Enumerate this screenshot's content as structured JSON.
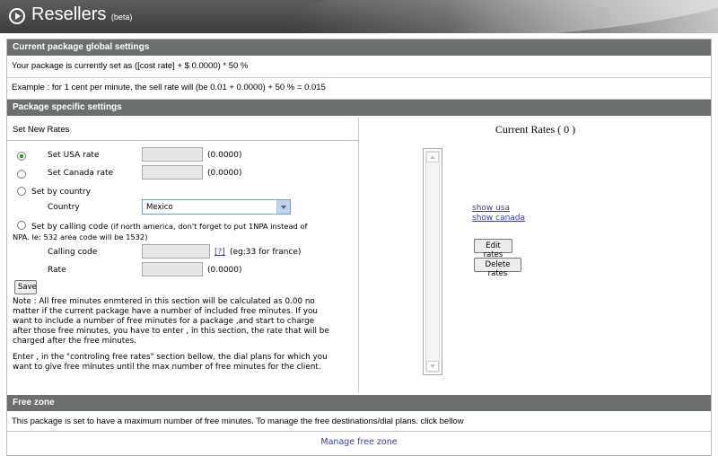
{
  "header": {
    "title": "Resellers",
    "title_badge": "(beta)"
  },
  "global": {
    "heading": "Current package global settings",
    "current_line": "Your package is currently set as ([cost rate] + $ 0.0000) * 50 %",
    "example_line": "Example : for 1 cent per minute, the sell rate will (be 0.01 + 0.0000) + 50 % = 0.015"
  },
  "specific": {
    "heading": "Package specific settings",
    "set_new_rates": "Set New Rates",
    "usa": {
      "label": "Set USA rate",
      "value": "",
      "current": "(0.0000)"
    },
    "canada": {
      "label": "Set Canada rate",
      "value": "",
      "current": "(0.0000)"
    },
    "by_country": {
      "label": "Set by country",
      "country_label": "Country",
      "country_value": "Mexico"
    },
    "by_calling_code": {
      "label": "Set by calling code",
      "hint": "(if north america, don't forget to put 1NPA instead of",
      "hint2": "NPA. Ie: 532 area code will be 1532)",
      "calling_code_label": "Calling code",
      "help_link": "[?]",
      "example": "(eg:33 for france)",
      "rate_label": "Rate",
      "rate_current": "(0.0000)"
    },
    "save_label": "Save",
    "note_lines": [
      "Note : All free minutes enmtered in this section will be calculated as 0.00 no",
      "matter if the current package have a number of included free minutes. If you",
      "want to include a number of free minutes for a package ,and start to charge",
      "after those free minutes, you have to enter , in this section, the rate that will be",
      "charged after the free minutes."
    ],
    "enter_lines": [
      "Enter , in the \"controling free rates\" section bellow, the dial plans for which you",
      "want to give free minutes until the max number of free minutes for the client."
    ]
  },
  "current_rates": {
    "title": "Current Rates ( 0 )",
    "show_usa": "show usa",
    "show_canada": "show canada",
    "edit_label": "Edit rates",
    "delete_label": "Delete rates"
  },
  "free_zone": {
    "heading": "Free zone",
    "description": "This package is set to have a maximum number of free minutes. To manage the free destinations/dial plans. click bellow",
    "manage_link": "Manage free zone"
  }
}
